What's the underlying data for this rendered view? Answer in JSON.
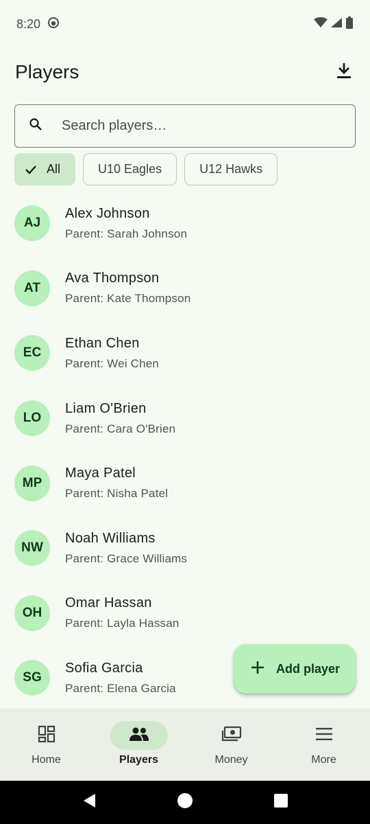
{
  "status_bar": {
    "time": "8:20"
  },
  "app_bar": {
    "title": "Players"
  },
  "search": {
    "placeholder": "Search players…"
  },
  "filters": [
    {
      "label": "All",
      "selected": true
    },
    {
      "label": "U10 Eagles",
      "selected": false
    },
    {
      "label": "U12 Hawks",
      "selected": false
    }
  ],
  "players": [
    {
      "initials": "AJ",
      "name": "Alex Johnson",
      "parent": "Parent: Sarah Johnson"
    },
    {
      "initials": "AT",
      "name": "Ava Thompson",
      "parent": "Parent: Kate Thompson"
    },
    {
      "initials": "EC",
      "name": "Ethan Chen",
      "parent": "Parent: Wei Chen"
    },
    {
      "initials": "LO",
      "name": "Liam O'Brien",
      "parent": "Parent: Cara O'Brien"
    },
    {
      "initials": "MP",
      "name": "Maya Patel",
      "parent": "Parent: Nisha Patel"
    },
    {
      "initials": "NW",
      "name": "Noah Williams",
      "parent": "Parent: Grace Williams"
    },
    {
      "initials": "OH",
      "name": "Omar Hassan",
      "parent": "Parent: Layla Hassan"
    },
    {
      "initials": "SG",
      "name": "Sofia Garcia",
      "parent": "Parent: Elena Garcia"
    }
  ],
  "fab": {
    "label": "Add player",
    "icon": "plus-icon"
  },
  "bottom_nav": [
    {
      "label": "Home",
      "icon": "dashboard-icon",
      "active": false
    },
    {
      "label": "Players",
      "icon": "people-icon",
      "active": true
    },
    {
      "label": "Money",
      "icon": "payments-icon",
      "active": false
    },
    {
      "label": "More",
      "icon": "menu-icon",
      "active": false
    }
  ],
  "colors": {
    "background": "#f5faf3",
    "avatar": "#b7f0b8",
    "selected_chip": "#cfe8cc",
    "fab": "#b8f0bc",
    "nav_bar": "#ebefe8"
  }
}
